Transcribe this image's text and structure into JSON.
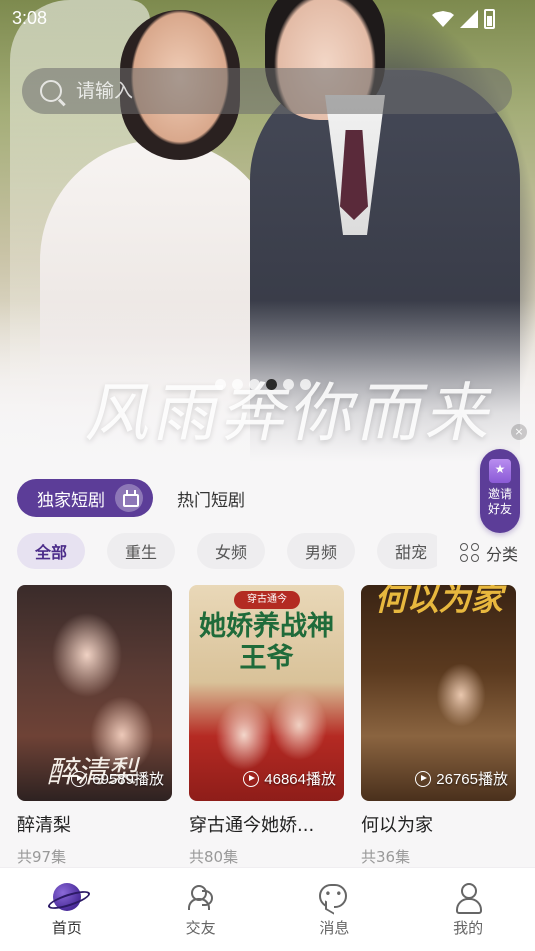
{
  "status_bar": {
    "time": "3:08"
  },
  "search": {
    "placeholder": "请输入"
  },
  "banner": {
    "title": "风雨奔你而来",
    "slide_count": 6,
    "active_slide": 3
  },
  "tabs": {
    "active": "独家短剧",
    "other": "热门短剧"
  },
  "invite": {
    "label": "邀请好友"
  },
  "categories": [
    "全部",
    "重生",
    "女频",
    "男频",
    "甜宠"
  ],
  "classify_label": "分类",
  "dramas": [
    {
      "title": "醉清梨",
      "plays": "69589播放",
      "episodes": "共97集",
      "poster_text": "醉清梨"
    },
    {
      "title": "穿古通今她娇...",
      "plays": "46864播放",
      "episodes": "共80集",
      "poster_banner": "穿古通今",
      "poster_text": "她娇养战神王爷"
    },
    {
      "title": "何以为家",
      "plays": "26765播放",
      "episodes": "共36集",
      "poster_text": "何以为家"
    }
  ],
  "nav": [
    {
      "label": "首页",
      "icon": "planet-icon",
      "active": true
    },
    {
      "label": "交友",
      "icon": "friends-icon"
    },
    {
      "label": "消息",
      "icon": "message-icon"
    },
    {
      "label": "我的",
      "icon": "user-icon"
    }
  ],
  "colors": {
    "accent": "#5c3d98",
    "background": "#f7f6f7"
  }
}
